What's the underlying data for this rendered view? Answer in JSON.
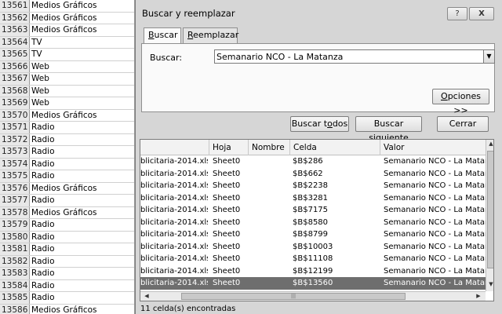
{
  "sheet": {
    "rows": [
      {
        "num": "13561",
        "value": "Medios Gráficos"
      },
      {
        "num": "13562",
        "value": "Medios Gráficos"
      },
      {
        "num": "13563",
        "value": "Medios Gráficos"
      },
      {
        "num": "13564",
        "value": "TV"
      },
      {
        "num": "13565",
        "value": "TV"
      },
      {
        "num": "13566",
        "value": "Web"
      },
      {
        "num": "13567",
        "value": "Web"
      },
      {
        "num": "13568",
        "value": "Web"
      },
      {
        "num": "13569",
        "value": "Web"
      },
      {
        "num": "13570",
        "value": "Medios Gráficos"
      },
      {
        "num": "13571",
        "value": "Radio"
      },
      {
        "num": "13572",
        "value": "Radio"
      },
      {
        "num": "13573",
        "value": "Radio"
      },
      {
        "num": "13574",
        "value": "Radio"
      },
      {
        "num": "13575",
        "value": "Radio"
      },
      {
        "num": "13576",
        "value": "Medios Gráficos"
      },
      {
        "num": "13577",
        "value": "Radio"
      },
      {
        "num": "13578",
        "value": "Medios Gráficos"
      },
      {
        "num": "13579",
        "value": "Radio"
      },
      {
        "num": "13580",
        "value": "Radio"
      },
      {
        "num": "13581",
        "value": "Radio"
      },
      {
        "num": "13582",
        "value": "Radio"
      },
      {
        "num": "13583",
        "value": "Radio"
      },
      {
        "num": "13584",
        "value": "Radio"
      },
      {
        "num": "13585",
        "value": "Radio"
      },
      {
        "num": "13586",
        "value": "Medios Gráficos"
      }
    ]
  },
  "dialog": {
    "title": "Buscar y reemplazar",
    "help_label": "?",
    "close_label": "X",
    "tabs": [
      {
        "label_hot": "B",
        "label_rest": "uscar"
      },
      {
        "label_hot": "R",
        "label_rest": "eemplazar"
      }
    ],
    "find_label": "Buscar:",
    "find_value": "Semanario NCO - La Matanza",
    "options_label_hot": "O",
    "options_label_rest": "pciones >>",
    "find_all_pre": "Buscar t",
    "find_all_hot": "o",
    "find_all_post": "dos",
    "find_next_pre": "Buscar ",
    "find_next_hot": "s",
    "find_next_post": "iguiente",
    "close_button": "Cerrar",
    "columns": [
      "",
      "Hoja",
      "Nombre",
      "Celda",
      "Valor"
    ],
    "results": [
      {
        "book": "blicitaria-2014.xls",
        "sheet": "Sheet0",
        "name": "",
        "cell": "$B$286",
        "value": "Semanario NCO - La Matanza"
      },
      {
        "book": "blicitaria-2014.xls",
        "sheet": "Sheet0",
        "name": "",
        "cell": "$B$662",
        "value": "Semanario NCO - La Matanza"
      },
      {
        "book": "blicitaria-2014.xls",
        "sheet": "Sheet0",
        "name": "",
        "cell": "$B$2238",
        "value": "Semanario NCO - La Matanza"
      },
      {
        "book": "blicitaria-2014.xls",
        "sheet": "Sheet0",
        "name": "",
        "cell": "$B$3281",
        "value": "Semanario NCO - La Matanza"
      },
      {
        "book": "blicitaria-2014.xls",
        "sheet": "Sheet0",
        "name": "",
        "cell": "$B$7175",
        "value": "Semanario NCO - La Matanza"
      },
      {
        "book": "blicitaria-2014.xls",
        "sheet": "Sheet0",
        "name": "",
        "cell": "$B$8580",
        "value": "Semanario NCO - La Matanza"
      },
      {
        "book": "blicitaria-2014.xls",
        "sheet": "Sheet0",
        "name": "",
        "cell": "$B$8799",
        "value": "Semanario NCO - La Matanza"
      },
      {
        "book": "blicitaria-2014.xls",
        "sheet": "Sheet0",
        "name": "",
        "cell": "$B$10003",
        "value": "Semanario NCO - La Matanza"
      },
      {
        "book": "blicitaria-2014.xls",
        "sheet": "Sheet0",
        "name": "",
        "cell": "$B$11108",
        "value": "Semanario NCO - La Matanza"
      },
      {
        "book": "blicitaria-2014.xls",
        "sheet": "Sheet0",
        "name": "",
        "cell": "$B$12199",
        "value": "Semanario NCO - La Matanza"
      },
      {
        "book": "blicitaria-2014.xls",
        "sheet": "Sheet0",
        "name": "",
        "cell": "$B$13560",
        "value": "Semanario NCO - La Matanza",
        "selected": true
      }
    ],
    "status": "11 celda(s) encontradas"
  }
}
